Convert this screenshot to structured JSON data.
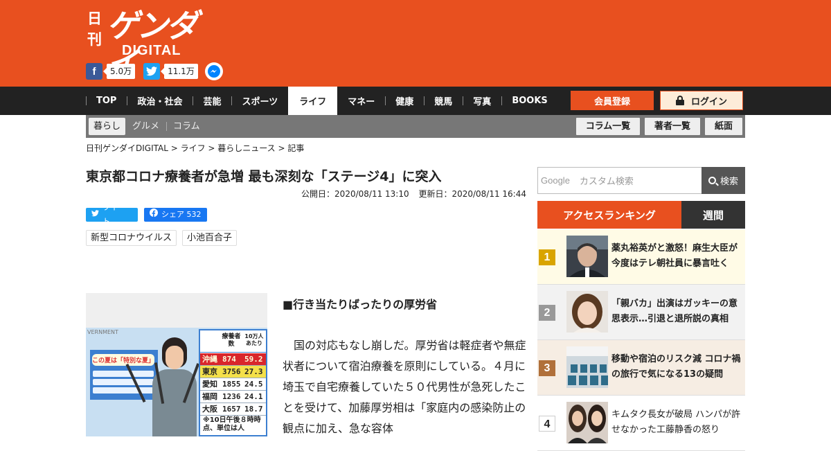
{
  "header": {
    "logo_kanji": "日刊",
    "logo_main": "ゲンダイ",
    "logo_sub": "DIGITAL",
    "social": {
      "facebook_icon": "facebook-icon",
      "facebook_count": "5.0万",
      "twitter_icon": "twitter-icon",
      "twitter_count": "11.1万",
      "messenger_icon": "messenger-icon"
    },
    "brand_color": "#e8501f"
  },
  "nav": {
    "items": [
      {
        "label": "TOP"
      },
      {
        "label": "政治・社会"
      },
      {
        "label": "芸能"
      },
      {
        "label": "スポーツ"
      },
      {
        "label": "ライフ",
        "active": true
      },
      {
        "label": "マネー"
      },
      {
        "label": "健康"
      },
      {
        "label": "競馬"
      },
      {
        "label": "写真"
      },
      {
        "label": "BOOKS"
      }
    ],
    "register_label": "会員登録",
    "login_label": "ログイン"
  },
  "subnav": {
    "items": [
      {
        "label": "暮らし",
        "active": true
      },
      {
        "label": "グルメ"
      },
      {
        "label": "コラム"
      }
    ],
    "buttons": [
      {
        "label": "コラム一覧"
      },
      {
        "label": "著者一覧"
      },
      {
        "label": "紙面"
      }
    ]
  },
  "breadcrumb": "日刊ゲンダイDIGITAL > ライフ > 暮らしニュース > 記事",
  "article": {
    "title": "東京都コロナ療養者が急増 最も深刻な「ステージ4」に突入",
    "published": "公開日：2020/08/11 13:10",
    "updated": "更新日：2020/08/11 16:44",
    "tweet_label": "ツイート",
    "share_label": "シェア 532",
    "tags": [
      "新型コロナウイルス",
      "小池百合子"
    ],
    "lead_heading": "■行き当たりばったりの厚労省",
    "lead_body": "　国の対応もなし崩しだ。厚労省は軽症者や無症状者について宿泊療養を原則にしている。４月に埼玉で自宅療養していた５０代男性が急死したことを受けて、加藤厚労相は「家庭内の感染防止の観点に加え、急な容体",
    "photo": {
      "logo_text": "VERNMENT",
      "sign_title": "この夏は「特別な夏」",
      "table_head_1": "療養者数",
      "table_head_2": "10万人あたり",
      "rows": [
        {
          "pref": "沖縄",
          "count": "874",
          "per": "59.2"
        },
        {
          "pref": "東京",
          "count": "3756",
          "per": "27.3"
        },
        {
          "pref": "愛知",
          "count": "1855",
          "per": "24.5"
        },
        {
          "pref": "福岡",
          "count": "1236",
          "per": "24.1"
        },
        {
          "pref": "大阪",
          "count": "1657",
          "per": "18.7"
        }
      ],
      "note": "※10日午後８時時点、単位は人"
    }
  },
  "sidebar": {
    "search_brand": "Google",
    "search_placeholder": "カスタム検索",
    "search_button": "検索",
    "ranking_title": "アクセスランキング",
    "ranking_tab": "週間",
    "ranking": [
      {
        "rank": "1",
        "text": "薬丸裕英がと激怒！麻生大臣が今度はテレ朝社員に暴言吐く",
        "color": "#d9a400",
        "bg": "#fffbe6"
      },
      {
        "rank": "2",
        "text": "「親バカ」出演はガッキーの意思表示…引退と退所説の真相",
        "color": "#999999",
        "bg": "#f2f2f2"
      },
      {
        "rank": "3",
        "text": "移動や宿泊のリスク減 コロナ禍の旅行で気になる13の疑問",
        "color": "#b0703a",
        "bg": "#f6ede3"
      },
      {
        "rank": "4",
        "text": "キムタク長女が破局 ハンパが許せなかった工藤静香の怒り",
        "color": "#222222",
        "bg": "#ffffff"
      }
    ]
  }
}
